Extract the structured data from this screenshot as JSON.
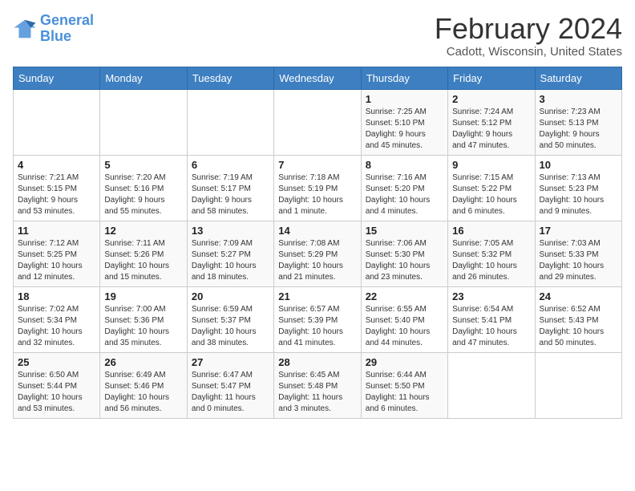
{
  "header": {
    "logo_line1": "General",
    "logo_line2": "Blue",
    "month": "February 2024",
    "location": "Cadott, Wisconsin, United States"
  },
  "weekdays": [
    "Sunday",
    "Monday",
    "Tuesday",
    "Wednesday",
    "Thursday",
    "Friday",
    "Saturday"
  ],
  "weeks": [
    [
      {
        "day": "",
        "info": ""
      },
      {
        "day": "",
        "info": ""
      },
      {
        "day": "",
        "info": ""
      },
      {
        "day": "",
        "info": ""
      },
      {
        "day": "1",
        "info": "Sunrise: 7:25 AM\nSunset: 5:10 PM\nDaylight: 9 hours\nand 45 minutes."
      },
      {
        "day": "2",
        "info": "Sunrise: 7:24 AM\nSunset: 5:12 PM\nDaylight: 9 hours\nand 47 minutes."
      },
      {
        "day": "3",
        "info": "Sunrise: 7:23 AM\nSunset: 5:13 PM\nDaylight: 9 hours\nand 50 minutes."
      }
    ],
    [
      {
        "day": "4",
        "info": "Sunrise: 7:21 AM\nSunset: 5:15 PM\nDaylight: 9 hours\nand 53 minutes."
      },
      {
        "day": "5",
        "info": "Sunrise: 7:20 AM\nSunset: 5:16 PM\nDaylight: 9 hours\nand 55 minutes."
      },
      {
        "day": "6",
        "info": "Sunrise: 7:19 AM\nSunset: 5:17 PM\nDaylight: 9 hours\nand 58 minutes."
      },
      {
        "day": "7",
        "info": "Sunrise: 7:18 AM\nSunset: 5:19 PM\nDaylight: 10 hours\nand 1 minute."
      },
      {
        "day": "8",
        "info": "Sunrise: 7:16 AM\nSunset: 5:20 PM\nDaylight: 10 hours\nand 4 minutes."
      },
      {
        "day": "9",
        "info": "Sunrise: 7:15 AM\nSunset: 5:22 PM\nDaylight: 10 hours\nand 6 minutes."
      },
      {
        "day": "10",
        "info": "Sunrise: 7:13 AM\nSunset: 5:23 PM\nDaylight: 10 hours\nand 9 minutes."
      }
    ],
    [
      {
        "day": "11",
        "info": "Sunrise: 7:12 AM\nSunset: 5:25 PM\nDaylight: 10 hours\nand 12 minutes."
      },
      {
        "day": "12",
        "info": "Sunrise: 7:11 AM\nSunset: 5:26 PM\nDaylight: 10 hours\nand 15 minutes."
      },
      {
        "day": "13",
        "info": "Sunrise: 7:09 AM\nSunset: 5:27 PM\nDaylight: 10 hours\nand 18 minutes."
      },
      {
        "day": "14",
        "info": "Sunrise: 7:08 AM\nSunset: 5:29 PM\nDaylight: 10 hours\nand 21 minutes."
      },
      {
        "day": "15",
        "info": "Sunrise: 7:06 AM\nSunset: 5:30 PM\nDaylight: 10 hours\nand 23 minutes."
      },
      {
        "day": "16",
        "info": "Sunrise: 7:05 AM\nSunset: 5:32 PM\nDaylight: 10 hours\nand 26 minutes."
      },
      {
        "day": "17",
        "info": "Sunrise: 7:03 AM\nSunset: 5:33 PM\nDaylight: 10 hours\nand 29 minutes."
      }
    ],
    [
      {
        "day": "18",
        "info": "Sunrise: 7:02 AM\nSunset: 5:34 PM\nDaylight: 10 hours\nand 32 minutes."
      },
      {
        "day": "19",
        "info": "Sunrise: 7:00 AM\nSunset: 5:36 PM\nDaylight: 10 hours\nand 35 minutes."
      },
      {
        "day": "20",
        "info": "Sunrise: 6:59 AM\nSunset: 5:37 PM\nDaylight: 10 hours\nand 38 minutes."
      },
      {
        "day": "21",
        "info": "Sunrise: 6:57 AM\nSunset: 5:39 PM\nDaylight: 10 hours\nand 41 minutes."
      },
      {
        "day": "22",
        "info": "Sunrise: 6:55 AM\nSunset: 5:40 PM\nDaylight: 10 hours\nand 44 minutes."
      },
      {
        "day": "23",
        "info": "Sunrise: 6:54 AM\nSunset: 5:41 PM\nDaylight: 10 hours\nand 47 minutes."
      },
      {
        "day": "24",
        "info": "Sunrise: 6:52 AM\nSunset: 5:43 PM\nDaylight: 10 hours\nand 50 minutes."
      }
    ],
    [
      {
        "day": "25",
        "info": "Sunrise: 6:50 AM\nSunset: 5:44 PM\nDaylight: 10 hours\nand 53 minutes."
      },
      {
        "day": "26",
        "info": "Sunrise: 6:49 AM\nSunset: 5:46 PM\nDaylight: 10 hours\nand 56 minutes."
      },
      {
        "day": "27",
        "info": "Sunrise: 6:47 AM\nSunset: 5:47 PM\nDaylight: 11 hours\nand 0 minutes."
      },
      {
        "day": "28",
        "info": "Sunrise: 6:45 AM\nSunset: 5:48 PM\nDaylight: 11 hours\nand 3 minutes."
      },
      {
        "day": "29",
        "info": "Sunrise: 6:44 AM\nSunset: 5:50 PM\nDaylight: 11 hours\nand 6 minutes."
      },
      {
        "day": "",
        "info": ""
      },
      {
        "day": "",
        "info": ""
      }
    ]
  ]
}
